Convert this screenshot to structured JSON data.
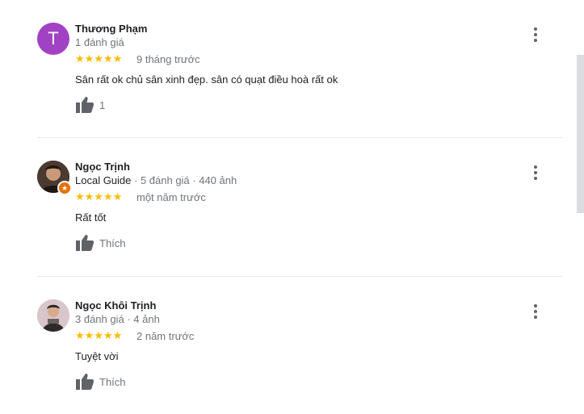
{
  "reviews": [
    {
      "avatar_letter": "T",
      "name": "Thương Phạm",
      "meta": "1 đánh giá",
      "stars": "★★★★★",
      "rating": 5,
      "time": "9 tháng trước",
      "text": "Sân rất ok chủ sân xinh đẹp. sân có quạt điều hoà rất ok",
      "like_label": "1"
    },
    {
      "name": "Ngọc Trịnh",
      "meta_guide": "Local Guide",
      "meta": " · 5 đánh giá · 440 ảnh",
      "stars": "★★★★★",
      "rating": 5,
      "time": "một năm trước",
      "text": "Rất tốt",
      "like_label": "Thích"
    },
    {
      "name": "Ngọc Khôi Trịnh",
      "meta": "3 đánh giá · 4 ảnh",
      "stars": "★★★★★",
      "rating": 5,
      "time": "2 năm trước",
      "text": "Tuyệt vời",
      "like_label": "Thích"
    }
  ],
  "icons": {
    "like": "thumbs-up-icon",
    "more": "more-vert-icon",
    "badge": "local-guide-badge-icon"
  },
  "colors": {
    "star": "#fbbc04",
    "avatar_purple": "#a142c4",
    "secondary_text": "#70757a",
    "badge_orange": "#e8710a"
  }
}
